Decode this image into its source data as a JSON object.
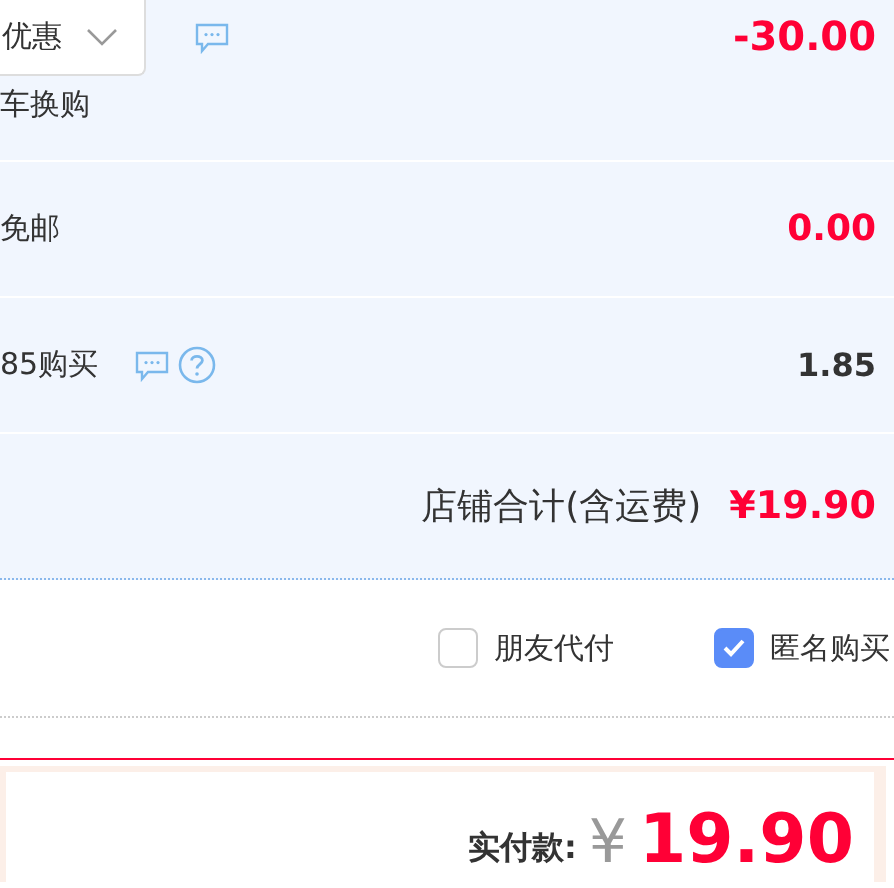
{
  "discount": {
    "dropdown": "优惠",
    "note": "车换购",
    "amount": "-30.00"
  },
  "shipping": {
    "label": "免邮",
    "amount": "0.00"
  },
  "extra": {
    "label": "85购买",
    "amount": "1.85"
  },
  "shop_total": {
    "label": "店铺合计(含运费)",
    "amount": "¥19.90"
  },
  "options": [
    {
      "label": "朋友代付",
      "checked": false
    },
    {
      "label": "匿名购买",
      "checked": true
    }
  ],
  "payment": {
    "label": "实付款:",
    "currency": "¥",
    "amount": "19.90"
  }
}
